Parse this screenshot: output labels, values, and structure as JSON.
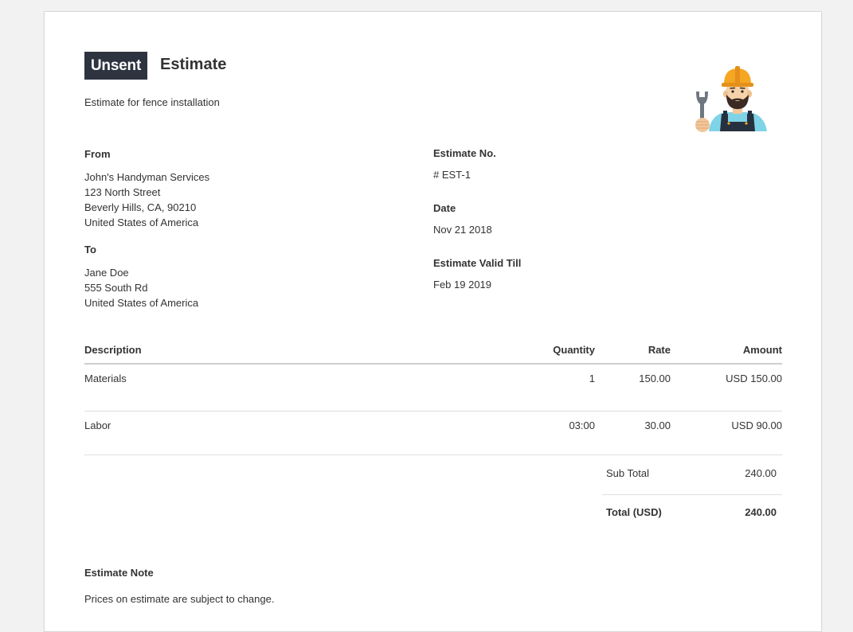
{
  "status_badge": "Unsent",
  "doc_title": "Estimate",
  "subtitle": "Estimate for fence installation",
  "from": {
    "label": "From",
    "lines": [
      "John's Handyman Services",
      "123 North Street",
      "Beverly Hills, CA, 90210",
      "United States of America"
    ]
  },
  "to": {
    "label": "To",
    "lines": [
      "Jane Doe",
      "555 South Rd",
      "United States of America"
    ]
  },
  "meta": {
    "estimate_no_label": "Estimate No.",
    "estimate_no": "# EST-1",
    "date_label": "Date",
    "date": "Nov 21 2018",
    "valid_till_label": "Estimate Valid Till",
    "valid_till": "Feb 19 2019"
  },
  "table": {
    "headers": [
      "Description",
      "Quantity",
      "Rate",
      "Amount"
    ],
    "rows": [
      {
        "description": "Materials",
        "quantity": "1",
        "rate": "150.00",
        "amount": "USD 150.00"
      },
      {
        "description": "Labor",
        "quantity": "03:00",
        "rate": "30.00",
        "amount": "USD 90.00"
      }
    ]
  },
  "totals": {
    "subtotal_label": "Sub Total",
    "subtotal": "240.00",
    "total_label": "Total (USD)",
    "total": "240.00"
  },
  "note": {
    "label": "Estimate Note",
    "text": "Prices on estimate are subject to change."
  },
  "colors": {
    "badge_bg": "#2e3340",
    "helmet": "#f5a623",
    "shirt": "#7fd3e6",
    "overalls": "#27303f"
  },
  "icons": {
    "avatar": "handyman-with-wrench-icon"
  }
}
